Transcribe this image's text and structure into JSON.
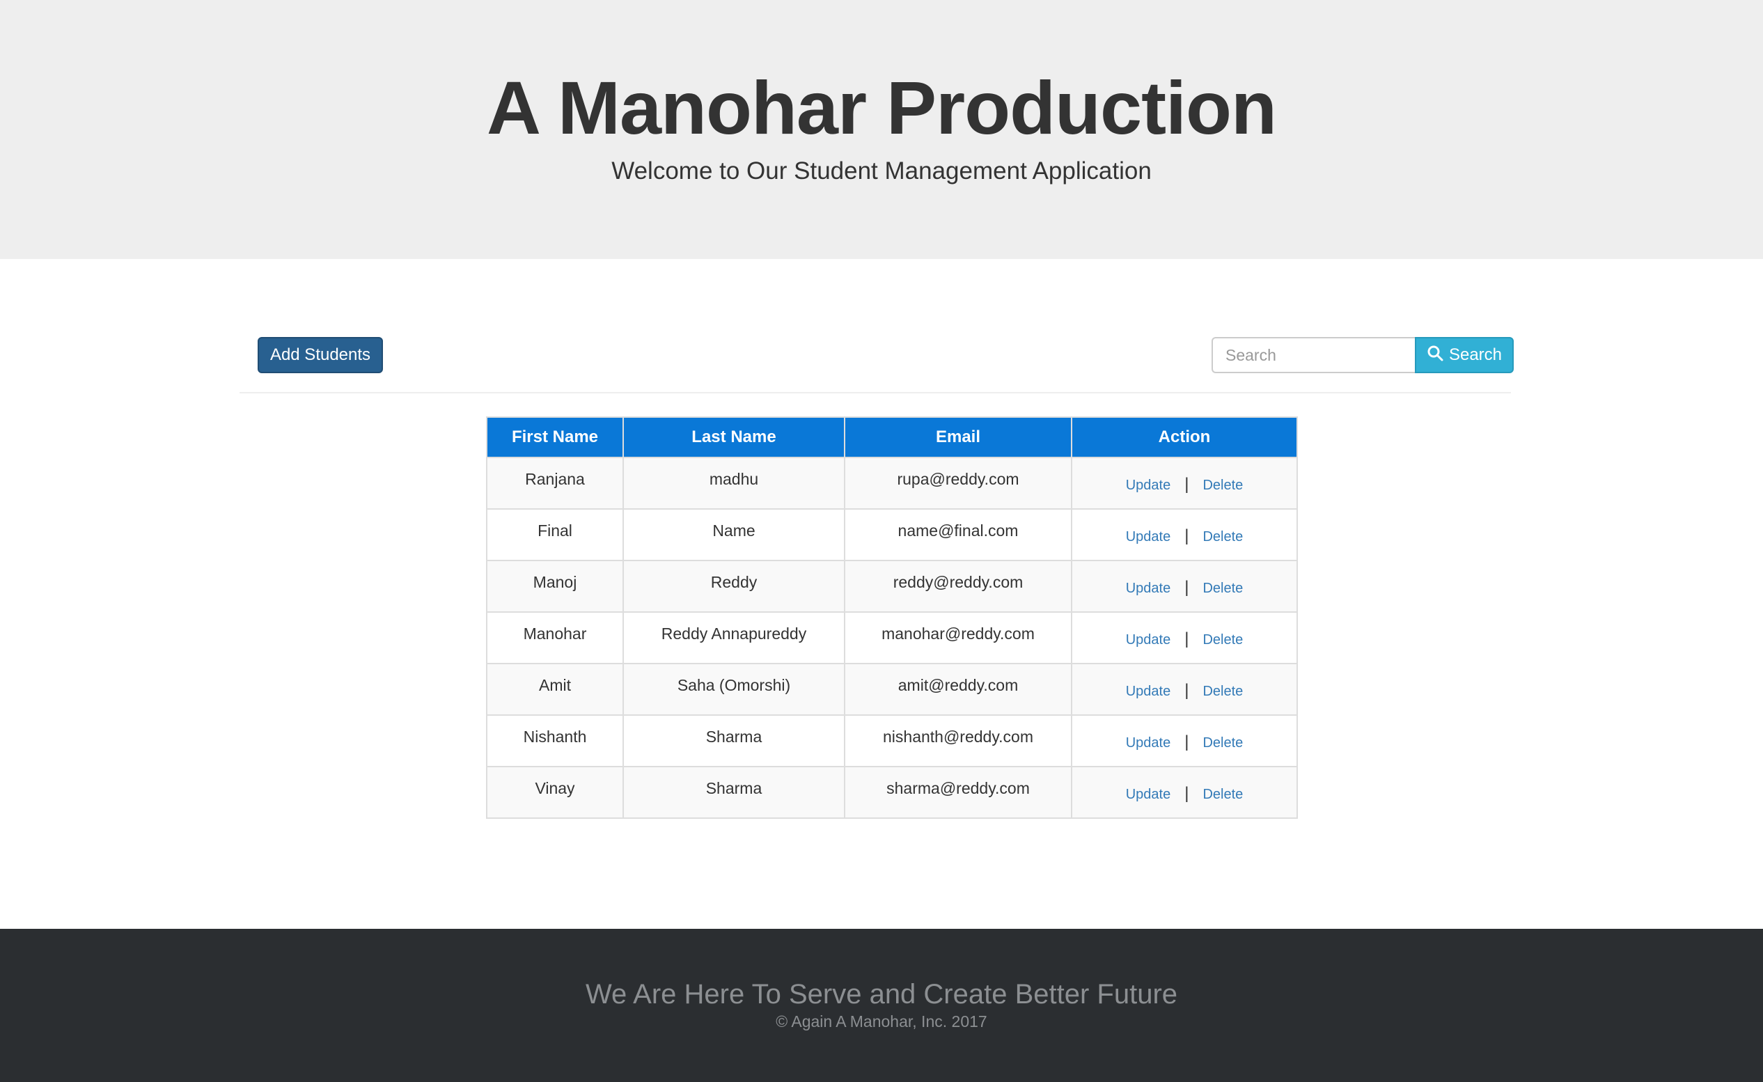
{
  "header": {
    "title": "A Manohar Production",
    "subtitle": "Welcome to Our Student Management Application"
  },
  "toolbar": {
    "add_label": "Add Students",
    "search_placeholder": "Search",
    "search_value": "",
    "search_button_label": "Search",
    "search_button_icon": "search-icon"
  },
  "table": {
    "columns": [
      "First Name",
      "Last Name",
      "Email",
      "Action"
    ],
    "rows": [
      {
        "first": "Ranjana",
        "last": "madhu",
        "email": "rupa@reddy.com"
      },
      {
        "first": "Final",
        "last": "Name",
        "email": "name@final.com"
      },
      {
        "first": "Manoj",
        "last": "Reddy",
        "email": "reddy@reddy.com"
      },
      {
        "first": "Manohar",
        "last": "Reddy Annapureddy",
        "email": "manohar@reddy.com"
      },
      {
        "first": "Amit",
        "last": "Saha (Omorshi)",
        "email": "amit@reddy.com"
      },
      {
        "first": "Nishanth",
        "last": "Sharma",
        "email": "nishanth@reddy.com"
      },
      {
        "first": "Vinay",
        "last": "Sharma",
        "email": "sharma@reddy.com"
      }
    ],
    "update_label": "Update",
    "delete_label": "Delete",
    "separator": "|"
  },
  "footer": {
    "tagline": "We Are Here To Serve and Create Better Future",
    "copyright": "© Again A Manohar, Inc. 2017"
  },
  "colors": {
    "header_bg": "#eeeeee",
    "primary_button": "#286090",
    "info_button": "#31b0d5",
    "table_header": "#0a78d7",
    "link": "#337ab7",
    "footer_bg": "#2b2e31"
  }
}
